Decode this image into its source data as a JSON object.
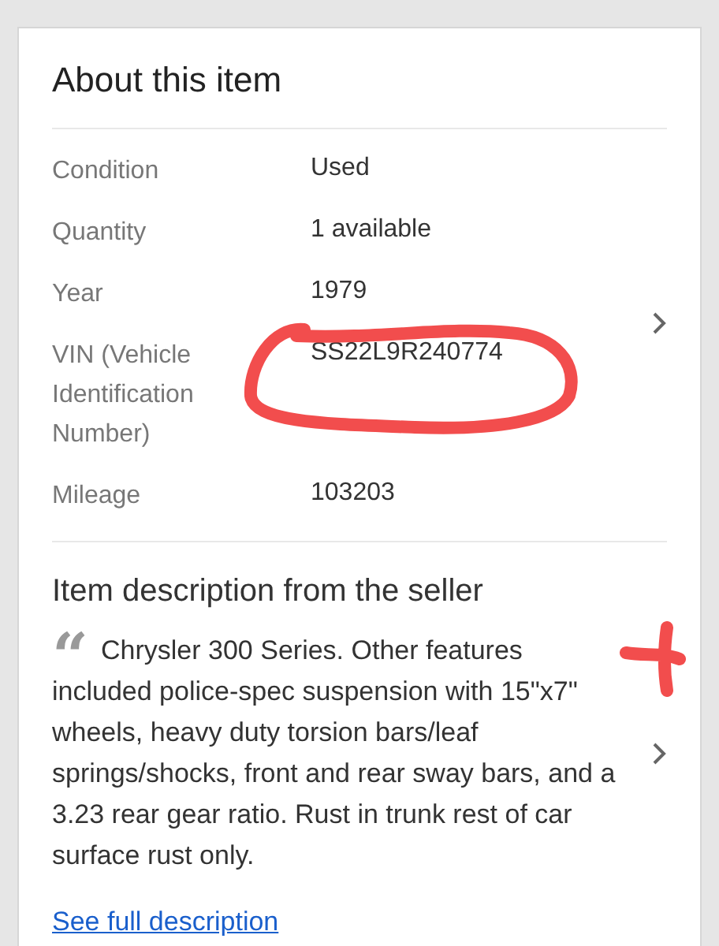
{
  "about": {
    "title": "About this item",
    "specs": [
      {
        "label": "Condition",
        "value": "Used"
      },
      {
        "label": "Quantity",
        "value": "1 available"
      },
      {
        "label": "Year",
        "value": "1979"
      },
      {
        "label": "VIN (Vehicle Identification Number)",
        "value": "SS22L9R240774"
      },
      {
        "label": "Mileage",
        "value": "103203"
      }
    ]
  },
  "description": {
    "title": "Item description from the seller",
    "quote_mark": "“",
    "text": "Chrysler 300 Series. Other features included police-spec suspension with 15\"x7\" wheels, heavy duty torsion bars/leaf springs/shocks, front and rear sway bars, and a 3.23 rear gear ratio. Rust in trunk rest of car surface rust only.",
    "link": "See full description"
  }
}
